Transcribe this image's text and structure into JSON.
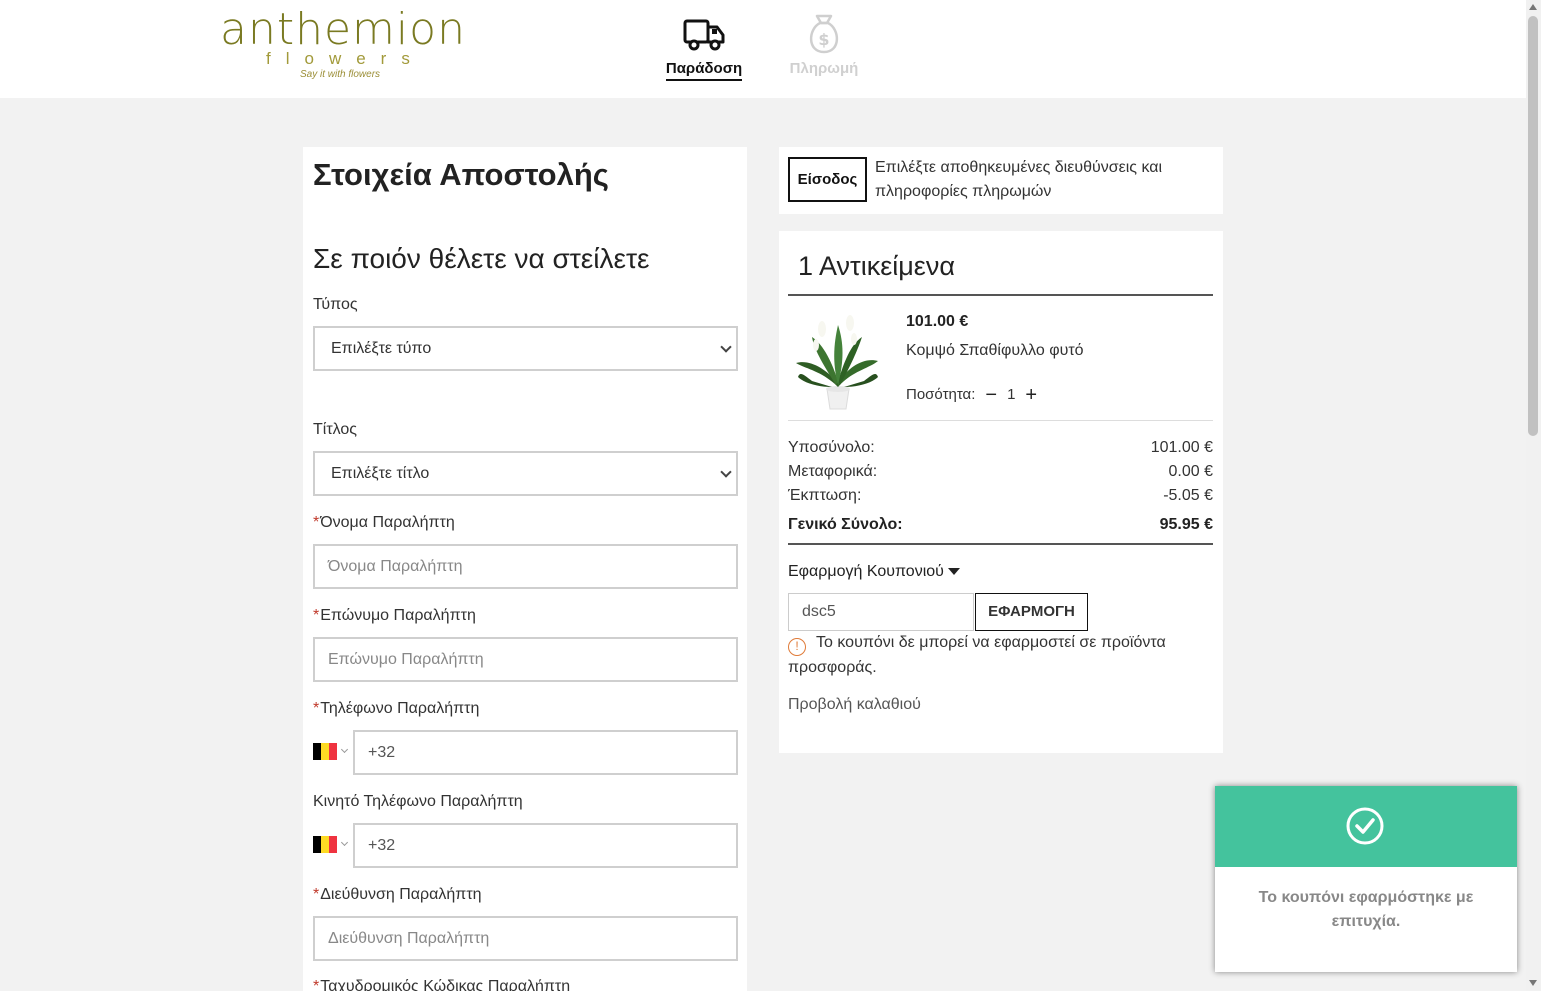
{
  "header": {
    "logo_main": "anthemion",
    "logo_sub": "flowers",
    "logo_tagline": "Say it with flowers",
    "steps": [
      {
        "label": "Παράδοση",
        "icon": "truck-icon",
        "active": true
      },
      {
        "label": "Πληρωμή",
        "icon": "money-bag-icon",
        "active": false
      }
    ]
  },
  "shipping": {
    "title": "Στοιχεία Αποστολής",
    "subtitle": "Σε ποιόν θέλετε να στείλετε",
    "type_label": "Τύπος",
    "type_value": "Επιλέξτε τύπο",
    "title_label": "Τίτλος",
    "title_value": "Επιλέξτε τίτλο",
    "first_name_label": "Όνομα Παραλήπτη",
    "first_name_placeholder": "Όνομα Παραλήπτη",
    "last_name_label": "Επώνυμο Παραλήπτη",
    "last_name_placeholder": "Επώνυμο Παραλήπτη",
    "phone_label": "Τηλέφωνο Παραλήπτη",
    "phone_value": "+32",
    "mobile_label": "Κινητό Τηλέφωνο Παραλήπτη",
    "mobile_value": "+32",
    "address_label": "Διεύθυνση Παραλήπτη",
    "address_placeholder": "Διεύθυνση Παραλήπτη",
    "postal_label": "Ταχυδρομικός Κώδικας Παραλήπτη",
    "required_mark": "*"
  },
  "login": {
    "button": "Είσοδος",
    "text": "Επιλέξτε αποθηκευμένες διευθύνσεις και πληροφορίες πληρωμών"
  },
  "cart": {
    "title": "1 Αντικείμενα",
    "item": {
      "price": "101.00 €",
      "name": "Κομψό Σπαθίφυλλο φυτό",
      "qty_label": "Ποσότητα:",
      "qty": "1",
      "minus": "−",
      "plus": "+"
    },
    "subtotal_label": "Υποσύνολο:",
    "subtotal": "101.00 €",
    "shipping_label": "Μεταφορικά:",
    "shipping": "0.00 €",
    "discount_label": "Έκπτωση:",
    "discount": "-5.05 €",
    "total_label": "Γενικό Σύνολο:",
    "total": "95.95 €",
    "coupon_toggle": "Εφαρμογή Κουπονιού",
    "coupon_value": "dsc5",
    "coupon_button": "ΕΦΑΡΜΟΓΗ",
    "coupon_error": "Το κουπόνι δε μπορεί να εφαρμοστεί σε προϊόντα προσφοράς.",
    "view_cart": "Προβολή καλαθιού"
  },
  "toast": {
    "message": "Το κουπόνι εφαρμόστηκε με επιτυχία.",
    "color": "#44c39d"
  },
  "colors": {
    "brand_olive": "#7a7a22",
    "belgium_flag": [
      "#000000",
      "#FDDA24",
      "#EF3340"
    ]
  }
}
